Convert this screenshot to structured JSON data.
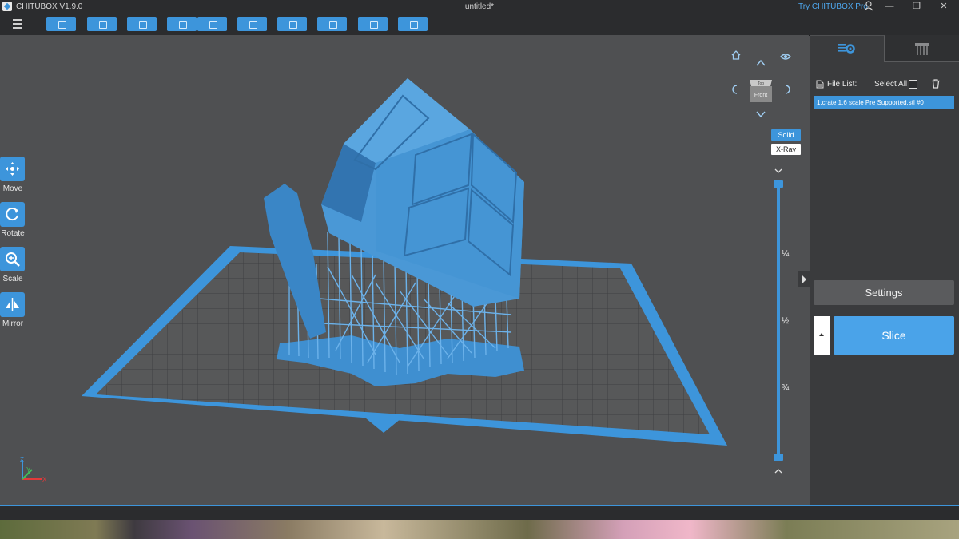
{
  "titlebar": {
    "app_title": "CHITUBOX V1.9.0",
    "document_title": "untitled*",
    "promo_link": "Try CHITUBOX Pro",
    "minimize": "—",
    "restore": "❐",
    "close": "✕"
  },
  "toolbar": {
    "icons": [
      "menu-icon",
      "open-file-icon",
      "save-icon",
      "import-icon",
      "undo-icon",
      "redo-icon",
      "model-list-icon",
      "layout-icon",
      "support-icon",
      "hollow-icon",
      "dig-hole-icon"
    ]
  },
  "left_tools": [
    {
      "label": "Move",
      "icon": "move-icon"
    },
    {
      "label": "Rotate",
      "icon": "rotate-icon"
    },
    {
      "label": "Scale",
      "icon": "scale-icon"
    },
    {
      "label": "Mirror",
      "icon": "mirror-icon"
    }
  ],
  "view_controls": {
    "cube_face": "Front",
    "cube_top": "Top",
    "solid_label": "Solid",
    "xray_label": "X-Ray"
  },
  "layer_slider": {
    "ticks": [
      "¼",
      "½",
      "¾"
    ]
  },
  "axes": {
    "x": "X",
    "y": "Y",
    "z": "Z"
  },
  "side_panel": {
    "file_list_label": "File List:",
    "select_all_label": "Select All",
    "files": [
      "1.crate 1.6 scale Pre Supported.stl #0"
    ],
    "settings_label": "Settings",
    "slice_label": "Slice"
  },
  "colors": {
    "accent": "#3d95db",
    "model": "#3f8fd0",
    "viewport_bg": "#4f5052",
    "chrome_bg": "#2b2c2e"
  }
}
